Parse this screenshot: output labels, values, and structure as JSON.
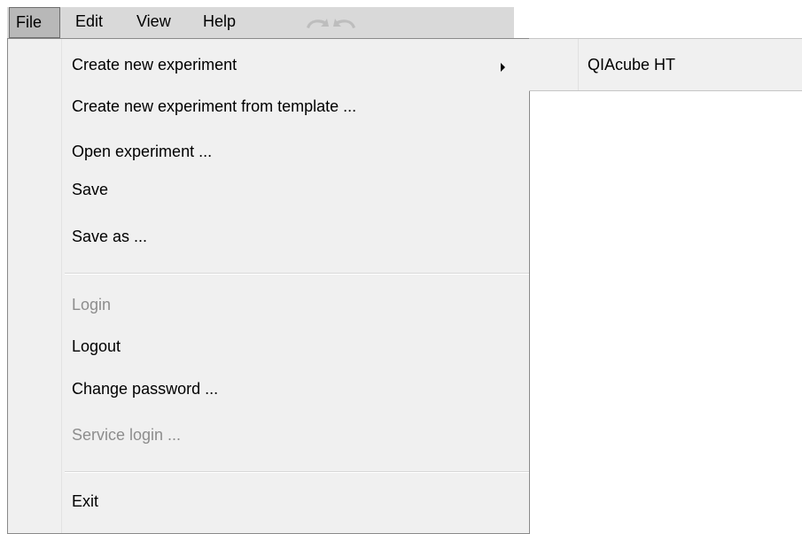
{
  "menubar": {
    "file": "File",
    "edit": "Edit",
    "view": "View",
    "help": "Help",
    "undo_icon": "undo-arrow-icon",
    "redo_icon": "redo-arrow-icon"
  },
  "file_menu": {
    "items": [
      {
        "label": "Create new experiment",
        "enabled": true,
        "submenu": true
      },
      {
        "label": "Create new experiment from template ...",
        "enabled": true
      },
      {
        "label": "Open experiment ...",
        "enabled": true
      },
      {
        "label": "Save",
        "enabled": true
      },
      {
        "label": "Save as ...",
        "enabled": true
      },
      {
        "label": "Login",
        "enabled": false
      },
      {
        "label": "Logout",
        "enabled": true
      },
      {
        "label": "Change password ...",
        "enabled": true
      },
      {
        "label": "Service login ...",
        "enabled": false
      },
      {
        "label": "Exit",
        "enabled": true
      }
    ]
  },
  "submenu": {
    "items": [
      {
        "label": "QIAcube HT"
      }
    ]
  },
  "colors": {
    "menubar_bg": "#d9d9d9",
    "active_menu_bg": "#b8b8b8",
    "menu_bg": "#f0f0f0",
    "disabled_text": "#8d8d8d"
  }
}
